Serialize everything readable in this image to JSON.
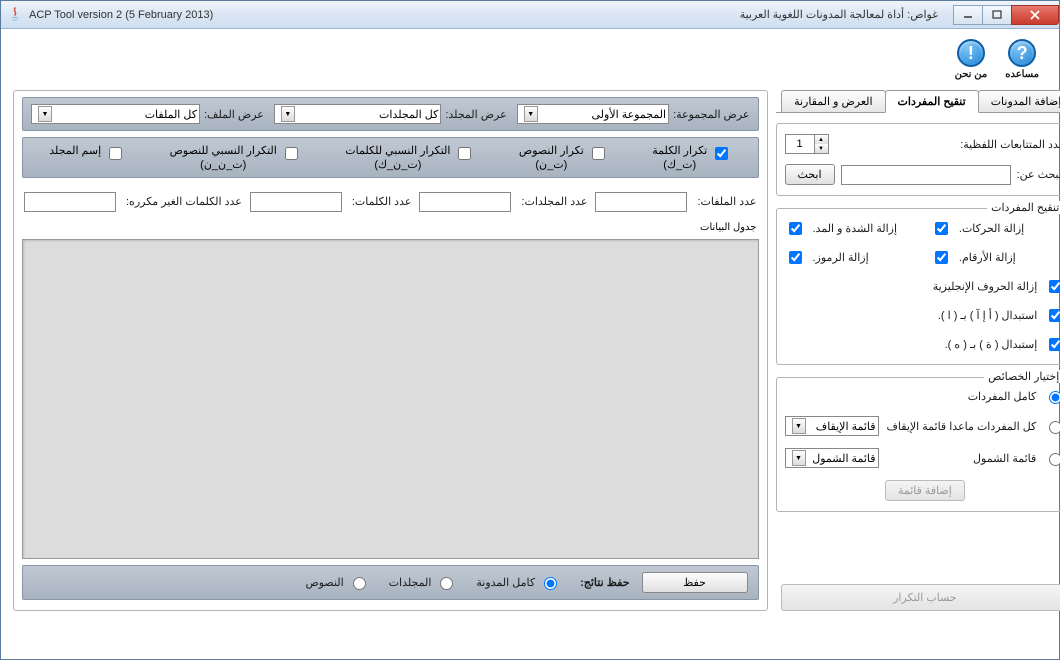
{
  "titlebar": {
    "title_left": "ACP Tool version 2 (5 February 2013)",
    "title_right": "غواص: أداة لمعالجة المدونات اللغوية العربية"
  },
  "help": {
    "about_label": "من نحن",
    "help_label": "مساعده"
  },
  "tabs": {
    "add_corpus": "إضافة المدونات",
    "refine_vocab": "تنقيح المفردات",
    "view_compare": "العرض و المقارنة"
  },
  "right": {
    "ngram_label": "عدد المتتابعات اللفظية:",
    "ngram_value": "1",
    "search_label": "البحث عن:",
    "search_btn": "ابحث",
    "refine_legend": "تنقيح المفردات",
    "chk_harakat": "إزالة الحركات.",
    "chk_shadda": "إزالة الشدة و المد.",
    "chk_arqam": "إزالة الأرقام.",
    "chk_rumuz": "إزالة الرموز.",
    "chk_english": "إزالة الحروف الإنجليزية",
    "chk_replace1": "استبدال ( أ إ آ ) بـ ( ا ).",
    "chk_replace2": "إستبدال ( ة ) بـ ( ه ).",
    "props_legend": "إختيار الخصائص",
    "radio_all_vocab": "كامل المفردات",
    "radio_except_stop": "كل المفردات ماعدا قائمة الإيقاف",
    "radio_include_list": "قائمة الشمول",
    "sel_stop": "قائمة الإيقاف",
    "sel_include": "قائمة الشمول",
    "add_list_btn": "إضافة قائمة",
    "calc_btn": "حساب التكرار"
  },
  "left": {
    "group_label": "عرض المجموعة:",
    "group_value": "المجموعة الأولى",
    "folder_label": "عرض المجلد:",
    "folder_value": "كل المجلدات",
    "file_label": "عرض الملف:",
    "file_value": "كل الملفات",
    "chk_word_freq": "تكرار الكلمة\n(ت_ك)",
    "chk_text_freq": "تكرار النصوص\n(ت_ن)",
    "chk_rel_word": "التكرار النسبي للكلمات\n(ت_ن_ك)",
    "chk_rel_text": "التكرار النسبي للنصوص\n(ت_ن_ن)",
    "chk_folder_name": "إسم المجلد",
    "stat_files": "عدد الملفات:",
    "stat_folders": "عدد المجلدات:",
    "stat_words": "عدد الكلمات:",
    "stat_unique": "عدد الكلمات الغير مكرره:",
    "table_label": "جدول البيانات"
  },
  "footer": {
    "save_label": "حفظ نتائج:",
    "radio_full": "كامل المدونة",
    "radio_folders": "المجلدات",
    "radio_texts": "النصوص",
    "save_btn": "حفظ"
  }
}
